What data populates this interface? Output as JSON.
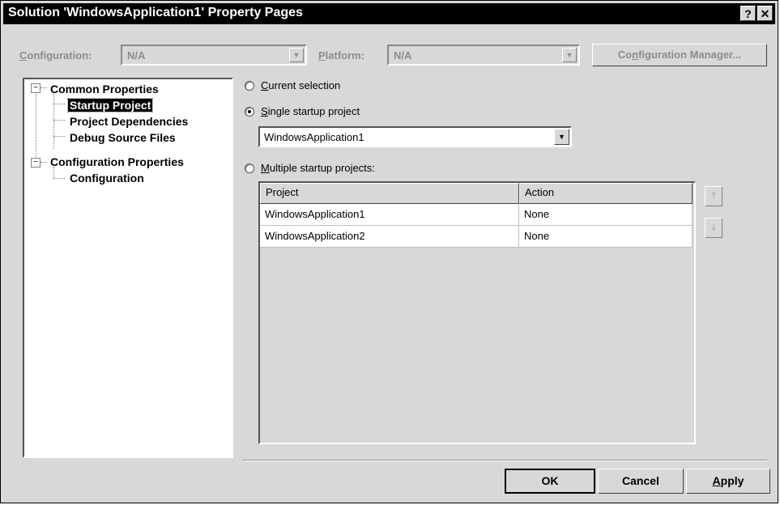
{
  "window": {
    "title": "Solution 'WindowsApplication1' Property Pages",
    "help_glyph": "?",
    "close_glyph": "✕"
  },
  "config": {
    "configuration_label": "Configuration:",
    "configuration_value": "N/A",
    "platform_label": "Platform:",
    "platform_value": "N/A",
    "manager_button": "Configuration Manager...",
    "arrow_glyph": "▼"
  },
  "tree": {
    "common": {
      "label": "Common Properties",
      "expander": "−"
    },
    "startup": "Startup Project",
    "dependencies": "Project Dependencies",
    "debug": "Debug Source Files",
    "configprops": {
      "label": "Configuration Properties",
      "expander": "−"
    },
    "configuration": "Configuration"
  },
  "startup": {
    "current_selection": {
      "label": "Current selection",
      "selected": false
    },
    "single": {
      "label": "Single startup project",
      "selected": true
    },
    "single_value": "WindowsApplication1",
    "multiple": {
      "label": "Multiple startup projects:",
      "selected": false
    }
  },
  "grid": {
    "headers": {
      "project": "Project",
      "action": "Action"
    },
    "rows": [
      {
        "project": "WindowsApplication1",
        "action": "None"
      },
      {
        "project": "WindowsApplication2",
        "action": "None"
      }
    ],
    "up_glyph": "🡑",
    "down_glyph": "🡓"
  },
  "buttons": {
    "ok": "OK",
    "cancel": "Cancel",
    "apply": "Apply"
  }
}
